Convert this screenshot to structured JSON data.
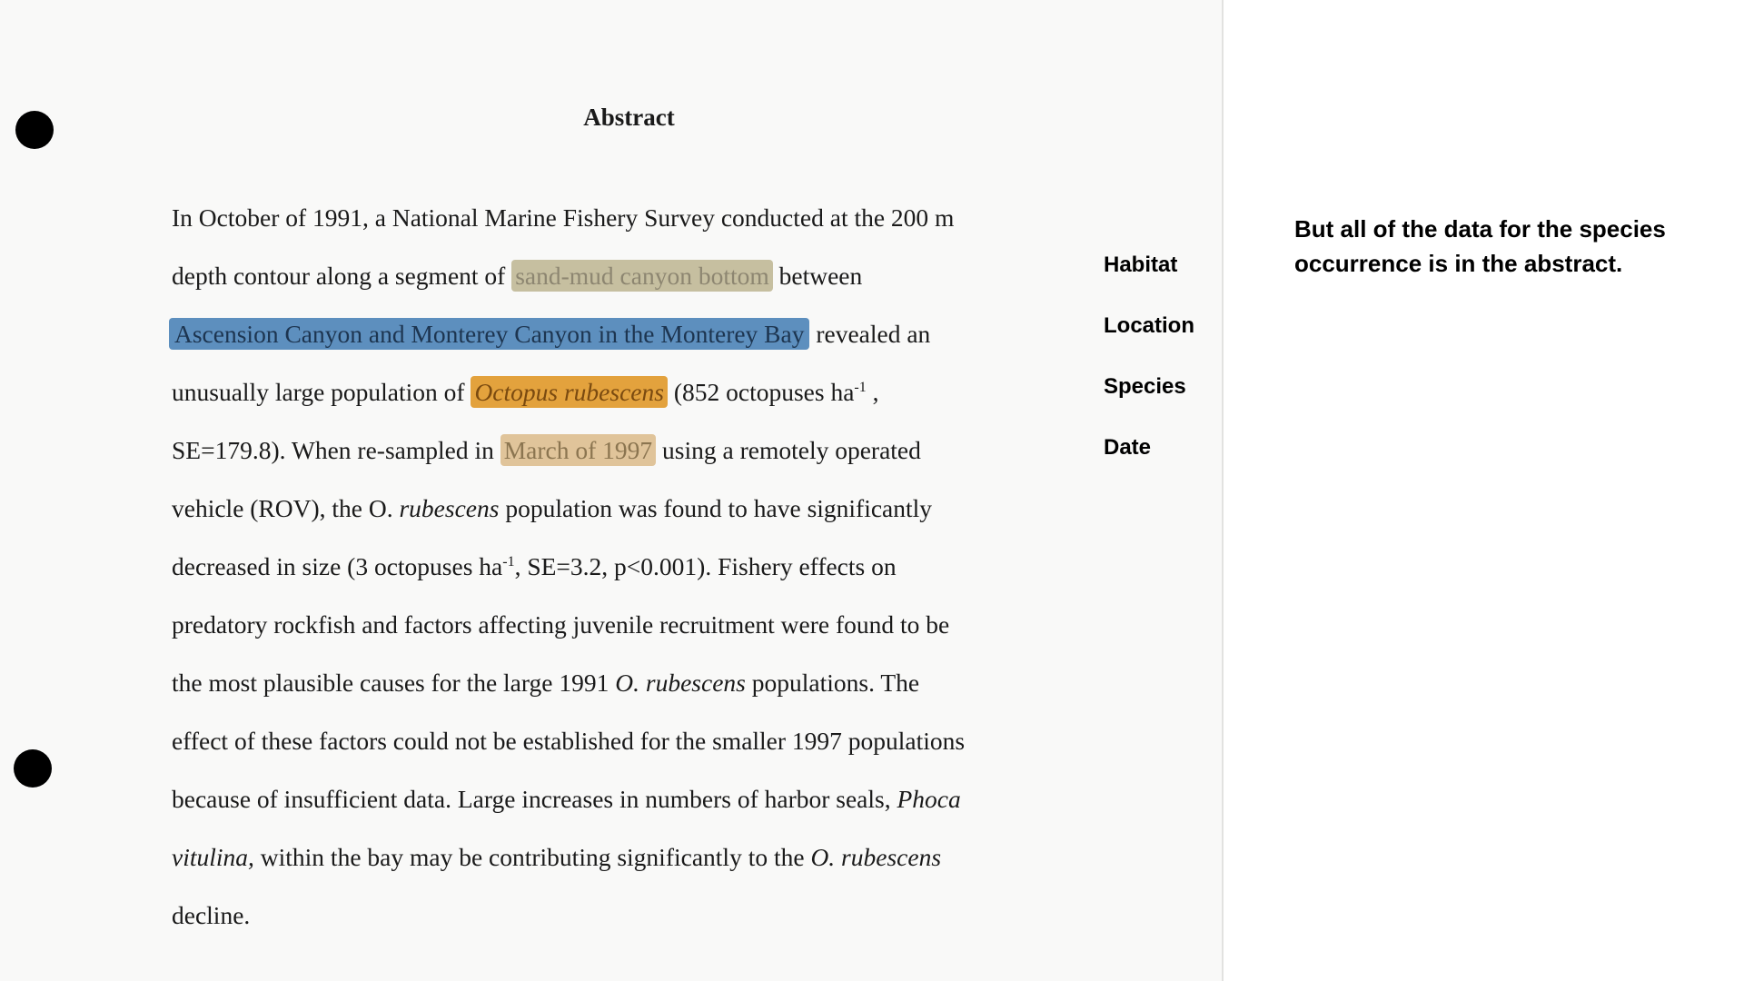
{
  "document": {
    "title": "Abstract",
    "lines": {
      "l1": "In October of 1991, a National Marine Fishery Survey conducted at the 200 m",
      "l2_pre": "depth contour along a segment of ",
      "l2_hl": "sand-mud canyon bottom",
      "l2_post": " between",
      "l3_hl": "Ascension Canyon and Monterey Canyon in the Monterey Bay",
      "l3_post": " revealed an",
      "l4_pre": "unusually large population of ",
      "l4_hl": "Octopus  rubescens",
      "l4_post": " (852 octopuses ha",
      "l4_sup": "-1",
      "l4_end": " ,",
      "l5_pre": "SE=179.8).  When re-sampled in ",
      "l5_hl": "March of 1997",
      "l5_post": " using a remotely operated",
      "l6_pre": "vehicle (ROV), the O. ",
      "l6_it": "rubescens",
      "l6_post": "  population was found to have significantly",
      "l7_pre": "decreased in size (3 octopuses ha",
      "l7_sup": "-1",
      "l7_post": ", SE=3.2, p<0.001).  Fishery effects on",
      "l8": "predatory rockfish and factors affecting juvenile recruitment were found to be",
      "l9_pre": "the most plausible causes for the large 1991 ",
      "l9_it": "O.  rubescens",
      "l9_post": "  populations. The",
      "l10": "effect of these factors could not be established for the smaller 1997 populations",
      "l11_pre": "because of insufficient data.  Large increases in numbers of harbor seals, ",
      "l11_it": "Phoca",
      "l12_it": "vitulina,",
      "l12_mid": "  within the bay may be contributing significantly to the ",
      "l12_it2": "O.  rubescens",
      "l13": "decline."
    }
  },
  "labels": {
    "habitat": "Habitat",
    "location": "Location",
    "species": "Species",
    "date": "Date"
  },
  "note": "But all of the data for the species occurrence is in the abstract.",
  "colors": {
    "habitat_highlight": "#c6bfa0",
    "location_highlight": "#5d8fbe",
    "species_highlight": "#e3a23d",
    "date_highlight": "#e0c49a"
  }
}
